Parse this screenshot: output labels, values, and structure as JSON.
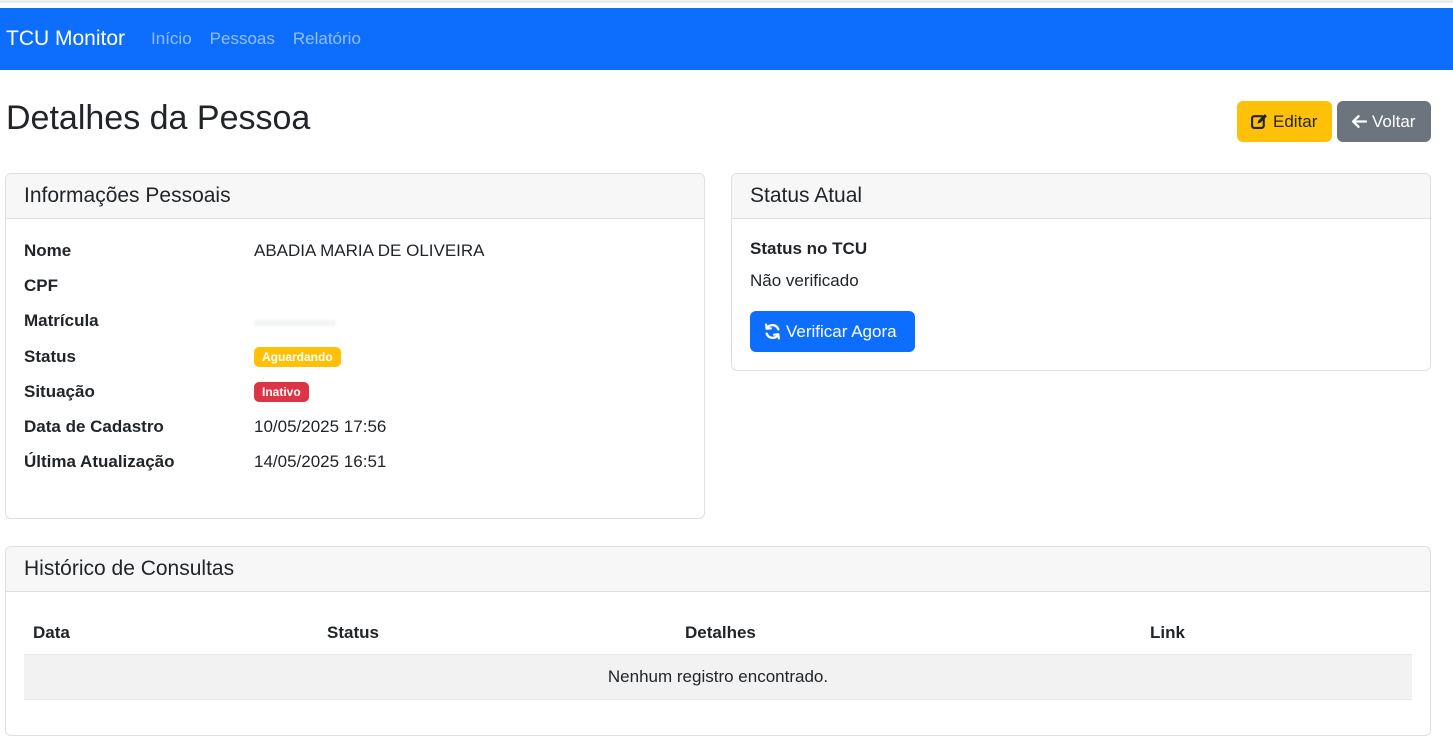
{
  "navbar": {
    "brand": "TCU Monitor",
    "links": [
      "Início",
      "Pessoas",
      "Relatório"
    ]
  },
  "page": {
    "title": "Detalhes da Pessoa",
    "edit_label": "Editar",
    "back_label": "Voltar"
  },
  "info_card": {
    "header": "Informações Pessoais",
    "rows": [
      {
        "label": "Nome",
        "value": "ABADIA MARIA DE OLIVEIRA"
      },
      {
        "label": "CPF",
        "value": ""
      },
      {
        "label": "Matrícula",
        "value": ""
      },
      {
        "label": "Status",
        "value": "Aguardando"
      },
      {
        "label": "Situação",
        "value": "Inativo"
      },
      {
        "label": "Data de Cadastro",
        "value": "10/05/2025 17:56"
      },
      {
        "label": "Última Atualização",
        "value": "14/05/2025 16:51"
      }
    ]
  },
  "status_card": {
    "header": "Status Atual",
    "label": "Status no TCU",
    "value": "Não verificado",
    "verify_label": "Verificar Agora"
  },
  "history_card": {
    "header": "Histórico de Consultas",
    "columns": [
      "Data",
      "Status",
      "Detalhes",
      "Link"
    ],
    "empty_message": "Nenhum registro encontrado."
  },
  "colors": {
    "primary": "#0d6efd",
    "warning": "#ffc107",
    "danger": "#dc3545",
    "secondary": "#6c757d"
  },
  "icons": {
    "edit": "pencil-square-icon",
    "back": "arrow-left-icon",
    "verify": "refresh-icon"
  }
}
